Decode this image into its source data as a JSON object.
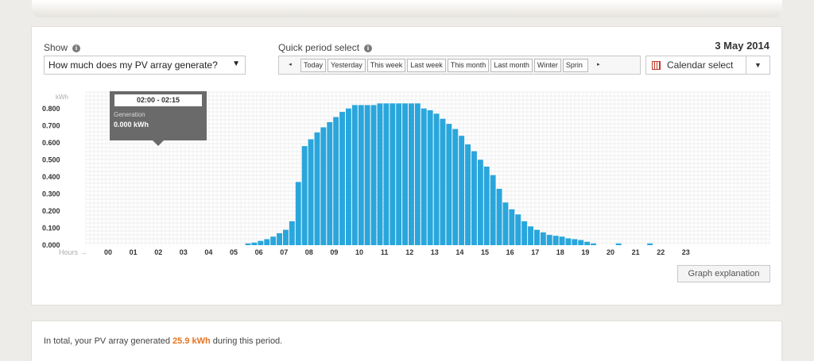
{
  "header": {
    "show_label": "Show",
    "show_value": "How much does my PV array generate?",
    "quick_label": "Quick period select",
    "date": "3 May 2014",
    "periods": [
      "Today",
      "Yesterday",
      "This week",
      "Last week",
      "This month",
      "Last month",
      "Winter",
      "Sprin"
    ],
    "nav_prev": "◂",
    "nav_next": "▸",
    "calendar_label": "Calendar select",
    "calendar_drop": "▼",
    "select_arrow": "▼",
    "info_glyph": "i"
  },
  "tooltip": {
    "time": "02:00 - 02:15",
    "series": "Generation",
    "value": "0.000 kWh"
  },
  "explain_button": "Graph explanation",
  "total": {
    "prefix": "In total, your PV array generated ",
    "value": "25.9 kWh",
    "suffix": " during this period."
  },
  "colors": {
    "bar": "#29a6dc",
    "highlight": "#e8731e",
    "tooltip_bg": "#6a6a6a"
  },
  "chart_data": {
    "type": "bar",
    "ylabel": "kWh",
    "xlabel": "Hours →",
    "ylim": [
      0,
      0.85
    ],
    "yticks": [
      "0.000",
      "0.100",
      "0.200",
      "0.300",
      "0.400",
      "0.500",
      "0.600",
      "0.700",
      "0.800"
    ],
    "xticks": [
      "00",
      "01",
      "02",
      "03",
      "04",
      "05",
      "06",
      "07",
      "08",
      "09",
      "10",
      "11",
      "12",
      "13",
      "14",
      "15",
      "16",
      "17",
      "18",
      "19",
      "20",
      "21",
      "22",
      "23"
    ],
    "interval_minutes": 15,
    "values": [
      0,
      0,
      0,
      0,
      0,
      0,
      0,
      0,
      0,
      0,
      0,
      0,
      0,
      0,
      0,
      0,
      0,
      0,
      0,
      0,
      0,
      0,
      0,
      0,
      0.01,
      0.015,
      0.025,
      0.035,
      0.05,
      0.07,
      0.09,
      0.14,
      0.37,
      0.58,
      0.62,
      0.66,
      0.69,
      0.72,
      0.75,
      0.78,
      0.8,
      0.82,
      0.82,
      0.82,
      0.82,
      0.83,
      0.83,
      0.83,
      0.83,
      0.83,
      0.83,
      0.83,
      0.8,
      0.79,
      0.77,
      0.74,
      0.71,
      0.68,
      0.64,
      0.59,
      0.55,
      0.5,
      0.46,
      0.41,
      0.33,
      0.25,
      0.21,
      0.18,
      0.14,
      0.11,
      0.09,
      0.075,
      0.06,
      0.055,
      0.05,
      0.04,
      0.035,
      0.03,
      0.02,
      0.01,
      0,
      0,
      0,
      0.01,
      0,
      0,
      0,
      0,
      0.01,
      0,
      0,
      0
    ]
  }
}
